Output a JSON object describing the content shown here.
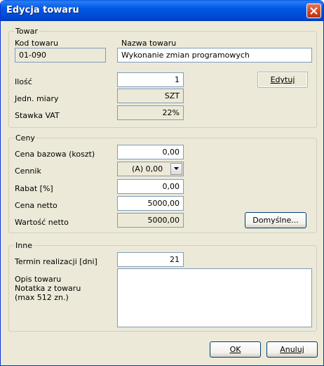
{
  "window": {
    "title": "Edycja towaru"
  },
  "towar": {
    "legend": "Towar",
    "kod_label": "Kod towaru",
    "kod_value": "01-090",
    "nazwa_label": "Nazwa towaru",
    "nazwa_value": "Wykonanie zmian programowych",
    "ilosc_label": "Ilość",
    "ilosc_value": "1",
    "edytuj_label": "Edytuj",
    "jm_label": "Jedn. miary",
    "jm_value": "SZT",
    "vat_label": "Stawka VAT",
    "vat_value": "22%"
  },
  "ceny": {
    "legend": "Ceny",
    "cena_bazowa_label": "Cena bazowa (koszt)",
    "cena_bazowa_value": "0,00",
    "cennik_label": "Cennik",
    "cennik_value": "(A)  0,00",
    "rabat_label": "Rabat [%]",
    "rabat_value": "0,00",
    "cena_netto_label": "Cena netto",
    "cena_netto_value": "5000,00",
    "wartosc_netto_label": "Wartość netto",
    "wartosc_netto_value": "5000,00",
    "domyslne_label": "Domyślne..."
  },
  "inne": {
    "legend": "Inne",
    "termin_label": "Termin realizacji [dni]",
    "termin_value": "21",
    "opis_line1": "Opis towaru",
    "opis_line2": "Notatka z towaru",
    "opis_line3": "(max 512 zn.)",
    "opis_value": ""
  },
  "buttons": {
    "ok_label": "OK",
    "anuluj_label": "Anuluj"
  }
}
